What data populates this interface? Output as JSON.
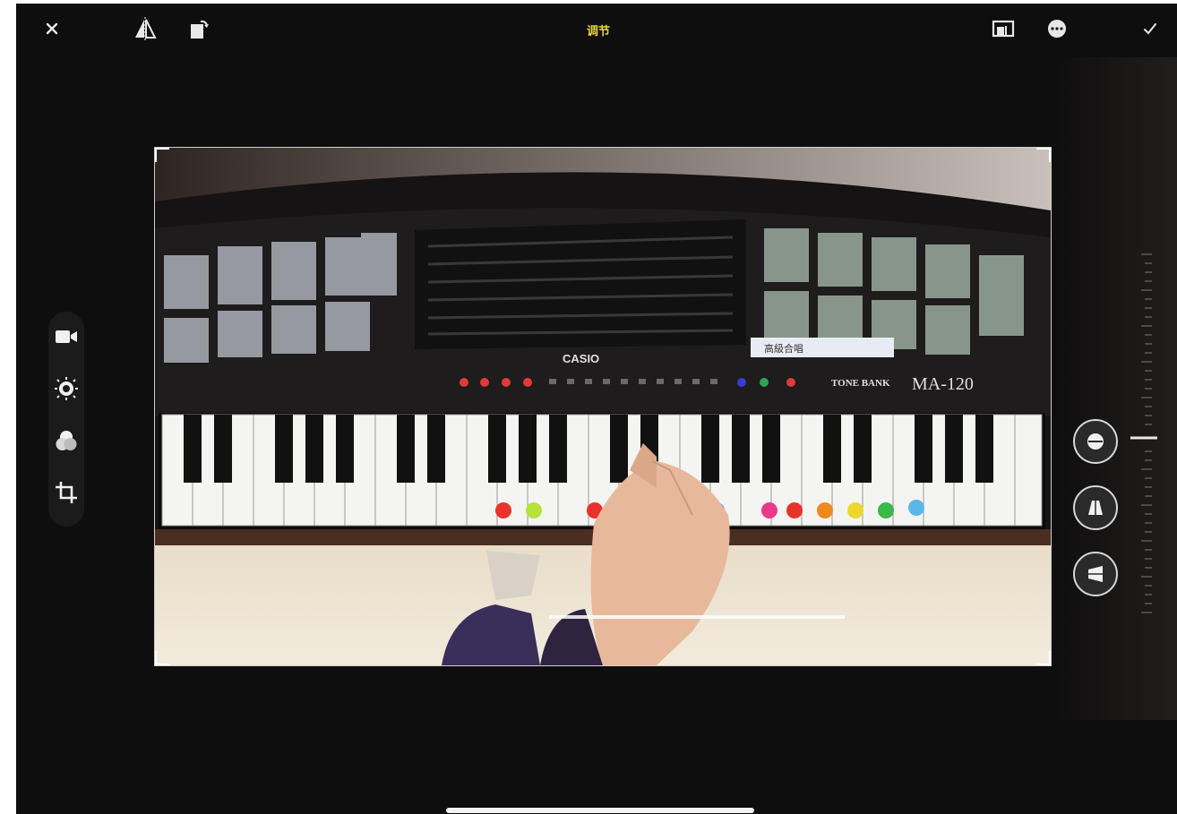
{
  "app": {
    "mode_label": "调节"
  },
  "toolbar": {
    "close_icon": "close-icon",
    "flip_icon": "flip-horizontal-icon",
    "rotate_icon": "rotate-icon",
    "aspect_icon": "aspect-ratio-icon",
    "more_icon": "more-icon",
    "done_icon": "checkmark-icon"
  },
  "left_tools": [
    "video-icon",
    "adjust-icon",
    "filters-icon",
    "crop-icon"
  ],
  "right_controls": [
    "straighten-icon",
    "vertical-perspective-icon",
    "horizontal-perspective-icon"
  ],
  "photo": {
    "brand_text": "CASIO",
    "model_text": "MA-120",
    "series_text": "TONE BANK",
    "display_text": "高級合唱"
  },
  "colors": {
    "accent": "#e6d23a",
    "background": "#0f0e0e"
  }
}
